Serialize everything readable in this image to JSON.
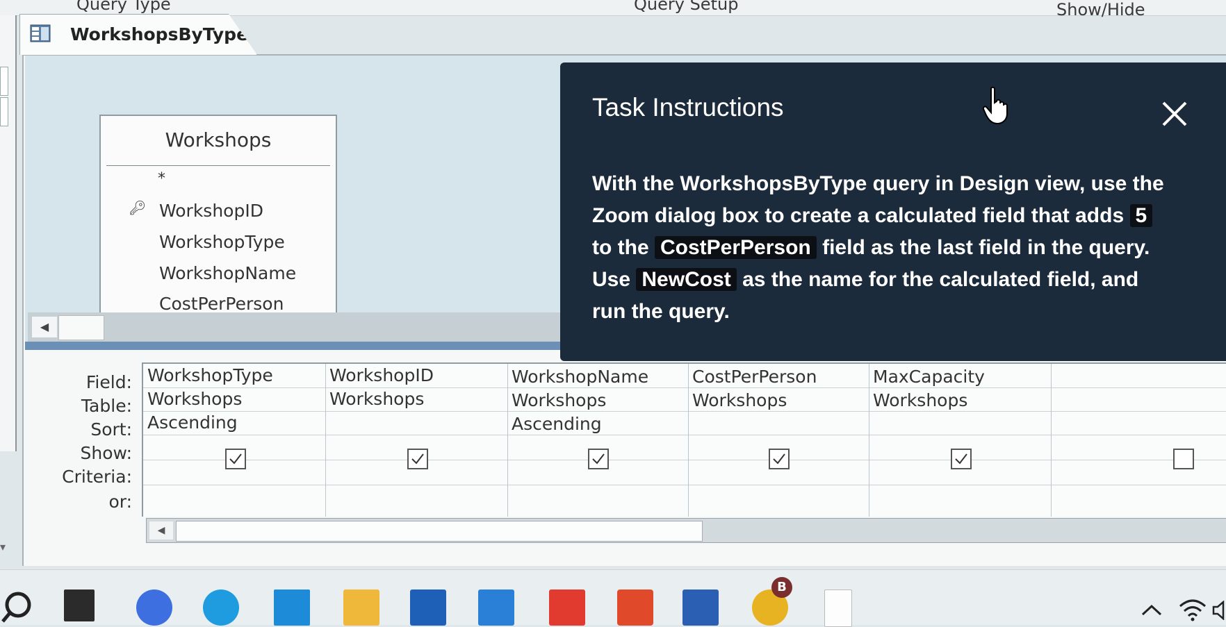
{
  "ribbon": {
    "group_query_type": "Query Type",
    "group_query_setup": "Query Setup",
    "group_show_hide": "Show/Hide"
  },
  "document": {
    "tab_title": "WorkshopsByType"
  },
  "table_box": {
    "title": "Workshops",
    "fields": [
      "*",
      "WorkshopID",
      "WorkshopType",
      "WorkshopName",
      "CostPerPerson"
    ]
  },
  "task": {
    "title": "Task Instructions",
    "line1": "With the WorkshopsByType query in Design view, use the",
    "line2_pre": "Zoom dialog box to create a calculated field that adds",
    "line2_value": "5",
    "line3_pre": "to the",
    "line3_field": "CostPerPerson",
    "line3_post": "field as the last field in the query.",
    "line4_pre": "Use",
    "line4_name": "NewCost",
    "line4_post": "as the name for the calculated field, and",
    "line5": "run the query."
  },
  "grid": {
    "row_labels": [
      "Field:",
      "Table:",
      "Sort:",
      "Show:",
      "Criteria:",
      "or:"
    ],
    "columns": [
      {
        "field": "WorkshopType",
        "table": "Workshops",
        "sort": "Ascending",
        "show": true
      },
      {
        "field": "WorkshopID",
        "table": "Workshops",
        "sort": "",
        "show": true
      },
      {
        "field": "WorkshopName",
        "table": "Workshops",
        "sort": "Ascending",
        "show": true
      },
      {
        "field": "CostPerPerson",
        "table": "Workshops",
        "sort": "",
        "show": true
      },
      {
        "field": "MaxCapacity",
        "table": "Workshops",
        "sort": "",
        "show": true
      },
      {
        "field": "",
        "table": "",
        "sort": "",
        "show": false
      }
    ]
  },
  "taskbar": {
    "chrome_badge": "B",
    "icons": [
      "search-icon",
      "file-explorer-dark-icon",
      "zoom-icon",
      "edge-icon",
      "calculator-icon",
      "folder-icon",
      "store-icon",
      "mail-icon",
      "slack-icon",
      "office-icon",
      "word-icon",
      "chrome-icon",
      "file-icon"
    ]
  },
  "colors": {
    "task_panel_bg": "#1c2b3b",
    "upper_pane_bg": "#d6e4ec",
    "splitter": "#6c8fb6"
  }
}
